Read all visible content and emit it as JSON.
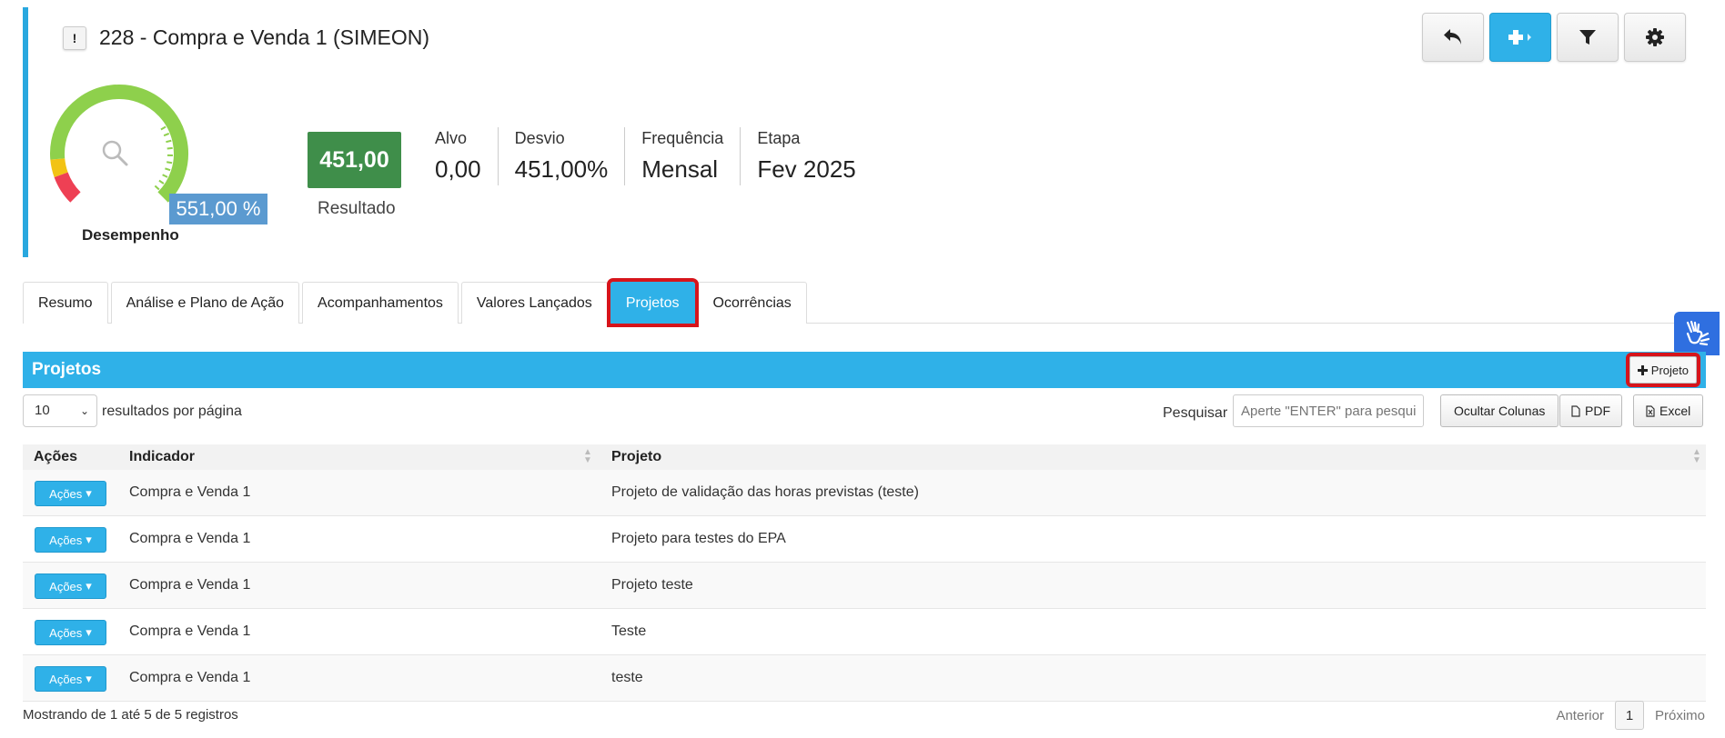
{
  "header": {
    "alert_label": "!",
    "title": "228 - Compra e Venda 1 (SIMEON)"
  },
  "toolbar": {
    "back_icon": "undo-icon",
    "add_icon": "plus-icon",
    "filter_icon": "filter-icon",
    "settings_icon": "gear-icon"
  },
  "gauge": {
    "percent_label": "551,00 %",
    "label": "Desempenho",
    "colors": {
      "green": "#8ed04c",
      "yellow": "#f2c314",
      "red": "#ee4054"
    }
  },
  "result": {
    "value": "451,00",
    "label": "Resultado",
    "color": "#3f8e4a"
  },
  "stats": [
    {
      "label": "Alvo",
      "value": "0,00"
    },
    {
      "label": "Desvio",
      "value": "451,00%"
    },
    {
      "label": "Frequência",
      "value": "Mensal"
    },
    {
      "label": "Etapa",
      "value": "Fev 2025"
    }
  ],
  "tabs": [
    {
      "label": "Resumo",
      "active": false
    },
    {
      "label": "Análise e Plano de Ação",
      "active": false
    },
    {
      "label": "Acompanhamentos",
      "active": false
    },
    {
      "label": "Valores Lançados",
      "active": false
    },
    {
      "label": "Projetos",
      "active": true
    },
    {
      "label": "Ocorrências",
      "active": false
    }
  ],
  "panel": {
    "title": "Projetos",
    "add_button": "Projeto"
  },
  "controls": {
    "page_size": "10",
    "page_size_label": "resultados por página",
    "search_label": "Pesquisar",
    "search_placeholder": "Aperte \"ENTER\" para pesquisar",
    "hide_columns": "Ocultar Colunas",
    "pdf": "PDF",
    "excel": "Excel"
  },
  "table": {
    "headers": {
      "actions": "Ações",
      "indicator": "Indicador",
      "project": "Projeto"
    },
    "action_label": "Ações",
    "rows": [
      {
        "indicator": "Compra e Venda 1",
        "project": "Projeto de validação das horas previstas (teste)"
      },
      {
        "indicator": "Compra e Venda 1",
        "project": "Projeto para testes do EPA"
      },
      {
        "indicator": "Compra e Venda 1",
        "project": "Projeto teste"
      },
      {
        "indicator": "Compra e Venda 1",
        "project": "Teste"
      },
      {
        "indicator": "Compra e Venda 1",
        "project": "teste"
      }
    ]
  },
  "footer": {
    "info": "Mostrando de 1 até 5 de 5 registros",
    "prev": "Anterior",
    "page": "1",
    "next": "Próximo"
  }
}
